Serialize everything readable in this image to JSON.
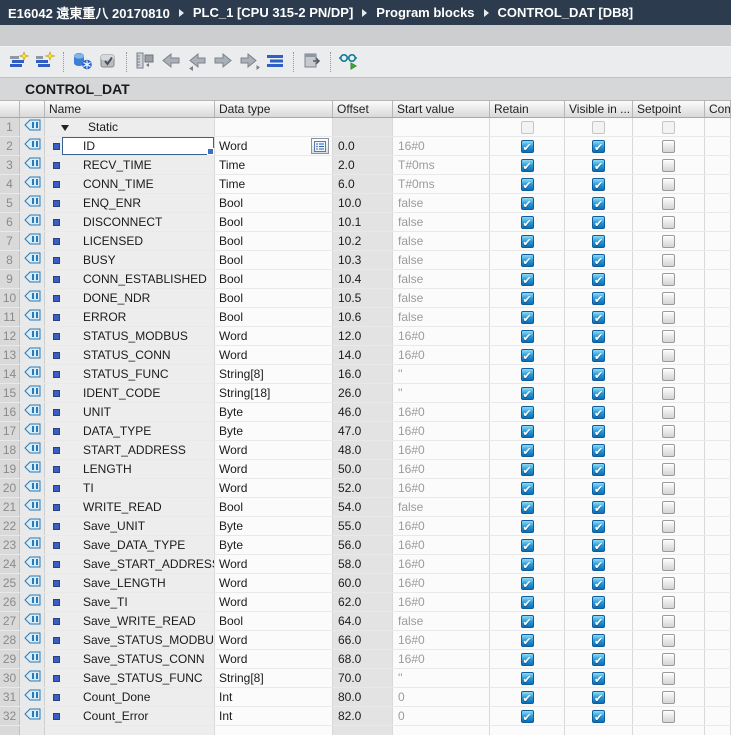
{
  "breadcrumb": {
    "items": [
      "E16042 遠東重八 20170810",
      "PLC_1 [CPU 315-2 PN/DP]",
      "Program blocks",
      "CONTROL_DAT [DB8]"
    ]
  },
  "toolbar": {
    "groups": [
      [
        "insert-row",
        "add-row"
      ],
      [
        "keep-actual-values",
        "snapshot-actual-values"
      ],
      [
        "copy-snapshots-to-start-values",
        "load-start-values",
        "copy-start-to-actual",
        "download-start-values",
        "copy-actual-to-start",
        "expanded-mode"
      ],
      [
        "download-without-reinit"
      ],
      [
        "monitor-all"
      ]
    ]
  },
  "block_title": "CONTROL_DAT",
  "table": {
    "headers": [
      "Name",
      "Data type",
      "Offset",
      "Start value",
      "Retain",
      "Visible in ...",
      "Setpoint",
      "Com..."
    ],
    "rows": [
      {
        "num": 1,
        "group": true,
        "name": "Static",
        "retain": "disabled",
        "visible": "disabled",
        "setpoint": "disabled"
      },
      {
        "num": 2,
        "name": "ID",
        "data_type": "Word",
        "offset": "0.0",
        "start_value": "16#0",
        "retain": true,
        "visible": true,
        "setpoint": false,
        "selected": true
      },
      {
        "num": 3,
        "name": "RECV_TIME",
        "data_type": "Time",
        "offset": "2.0",
        "start_value": "T#0ms",
        "retain": true,
        "visible": true,
        "setpoint": false
      },
      {
        "num": 4,
        "name": "CONN_TIME",
        "data_type": "Time",
        "offset": "6.0",
        "start_value": "T#0ms",
        "retain": true,
        "visible": true,
        "setpoint": false
      },
      {
        "num": 5,
        "name": "ENQ_ENR",
        "data_type": "Bool",
        "offset": "10.0",
        "start_value": "false",
        "retain": true,
        "visible": true,
        "setpoint": false
      },
      {
        "num": 6,
        "name": "DISCONNECT",
        "data_type": "Bool",
        "offset": "10.1",
        "start_value": "false",
        "retain": true,
        "visible": true,
        "setpoint": false
      },
      {
        "num": 7,
        "name": "LICENSED",
        "data_type": "Bool",
        "offset": "10.2",
        "start_value": "false",
        "retain": true,
        "visible": true,
        "setpoint": false
      },
      {
        "num": 8,
        "name": "BUSY",
        "data_type": "Bool",
        "offset": "10.3",
        "start_value": "false",
        "retain": true,
        "visible": true,
        "setpoint": false
      },
      {
        "num": 9,
        "name": "CONN_ESTABLISHED",
        "data_type": "Bool",
        "offset": "10.4",
        "start_value": "false",
        "retain": true,
        "visible": true,
        "setpoint": false
      },
      {
        "num": 10,
        "name": "DONE_NDR",
        "data_type": "Bool",
        "offset": "10.5",
        "start_value": "false",
        "retain": true,
        "visible": true,
        "setpoint": false
      },
      {
        "num": 11,
        "name": "ERROR",
        "data_type": "Bool",
        "offset": "10.6",
        "start_value": "false",
        "retain": true,
        "visible": true,
        "setpoint": false
      },
      {
        "num": 12,
        "name": "STATUS_MODBUS",
        "data_type": "Word",
        "offset": "12.0",
        "start_value": "16#0",
        "retain": true,
        "visible": true,
        "setpoint": false
      },
      {
        "num": 13,
        "name": "STATUS_CONN",
        "data_type": "Word",
        "offset": "14.0",
        "start_value": "16#0",
        "retain": true,
        "visible": true,
        "setpoint": false
      },
      {
        "num": 14,
        "name": "STATUS_FUNC",
        "data_type": "String[8]",
        "offset": "16.0",
        "start_value": "''",
        "retain": true,
        "visible": true,
        "setpoint": false
      },
      {
        "num": 15,
        "name": "IDENT_CODE",
        "data_type": "String[18]",
        "offset": "26.0",
        "start_value": "''",
        "retain": true,
        "visible": true,
        "setpoint": false
      },
      {
        "num": 16,
        "name": "UNIT",
        "data_type": "Byte",
        "offset": "46.0",
        "start_value": "16#0",
        "retain": true,
        "visible": true,
        "setpoint": false
      },
      {
        "num": 17,
        "name": "DATA_TYPE",
        "data_type": "Byte",
        "offset": "47.0",
        "start_value": "16#0",
        "retain": true,
        "visible": true,
        "setpoint": false
      },
      {
        "num": 18,
        "name": "START_ADDRESS",
        "data_type": "Word",
        "offset": "48.0",
        "start_value": "16#0",
        "retain": true,
        "visible": true,
        "setpoint": false
      },
      {
        "num": 19,
        "name": "LENGTH",
        "data_type": "Word",
        "offset": "50.0",
        "start_value": "16#0",
        "retain": true,
        "visible": true,
        "setpoint": false
      },
      {
        "num": 20,
        "name": "TI",
        "data_type": "Word",
        "offset": "52.0",
        "start_value": "16#0",
        "retain": true,
        "visible": true,
        "setpoint": false
      },
      {
        "num": 21,
        "name": "WRITE_READ",
        "data_type": "Bool",
        "offset": "54.0",
        "start_value": "false",
        "retain": true,
        "visible": true,
        "setpoint": false
      },
      {
        "num": 22,
        "name": "Save_UNIT",
        "data_type": "Byte",
        "offset": "55.0",
        "start_value": "16#0",
        "retain": true,
        "visible": true,
        "setpoint": false
      },
      {
        "num": 23,
        "name": "Save_DATA_TYPE",
        "data_type": "Byte",
        "offset": "56.0",
        "start_value": "16#0",
        "retain": true,
        "visible": true,
        "setpoint": false
      },
      {
        "num": 24,
        "name": "Save_START_ADDRESS",
        "data_type": "Word",
        "offset": "58.0",
        "start_value": "16#0",
        "retain": true,
        "visible": true,
        "setpoint": false
      },
      {
        "num": 25,
        "name": "Save_LENGTH",
        "data_type": "Word",
        "offset": "60.0",
        "start_value": "16#0",
        "retain": true,
        "visible": true,
        "setpoint": false
      },
      {
        "num": 26,
        "name": "Save_TI",
        "data_type": "Word",
        "offset": "62.0",
        "start_value": "16#0",
        "retain": true,
        "visible": true,
        "setpoint": false
      },
      {
        "num": 27,
        "name": "Save_WRITE_READ",
        "data_type": "Bool",
        "offset": "64.0",
        "start_value": "false",
        "retain": true,
        "visible": true,
        "setpoint": false
      },
      {
        "num": 28,
        "name": "Save_STATUS_MODBUS",
        "data_type": "Word",
        "offset": "66.0",
        "start_value": "16#0",
        "retain": true,
        "visible": true,
        "setpoint": false
      },
      {
        "num": 29,
        "name": "Save_STATUS_CONN",
        "data_type": "Word",
        "offset": "68.0",
        "start_value": "16#0",
        "retain": true,
        "visible": true,
        "setpoint": false
      },
      {
        "num": 30,
        "name": "Save_STATUS_FUNC",
        "data_type": "String[8]",
        "offset": "70.0",
        "start_value": "''",
        "retain": true,
        "visible": true,
        "setpoint": false
      },
      {
        "num": 31,
        "name": "Count_Done",
        "data_type": "Int",
        "offset": "80.0",
        "start_value": "0",
        "retain": true,
        "visible": true,
        "setpoint": false
      },
      {
        "num": 32,
        "name": "Count_Error",
        "data_type": "Int",
        "offset": "82.0",
        "start_value": "0",
        "retain": true,
        "visible": true,
        "setpoint": false
      }
    ]
  },
  "colors": {
    "breadcrumb_bg": "#2d3b4f",
    "checkbox_checked": "#1b82c8",
    "selection_border": "#39618f",
    "offset_column_bg": "#e3e3e3"
  }
}
